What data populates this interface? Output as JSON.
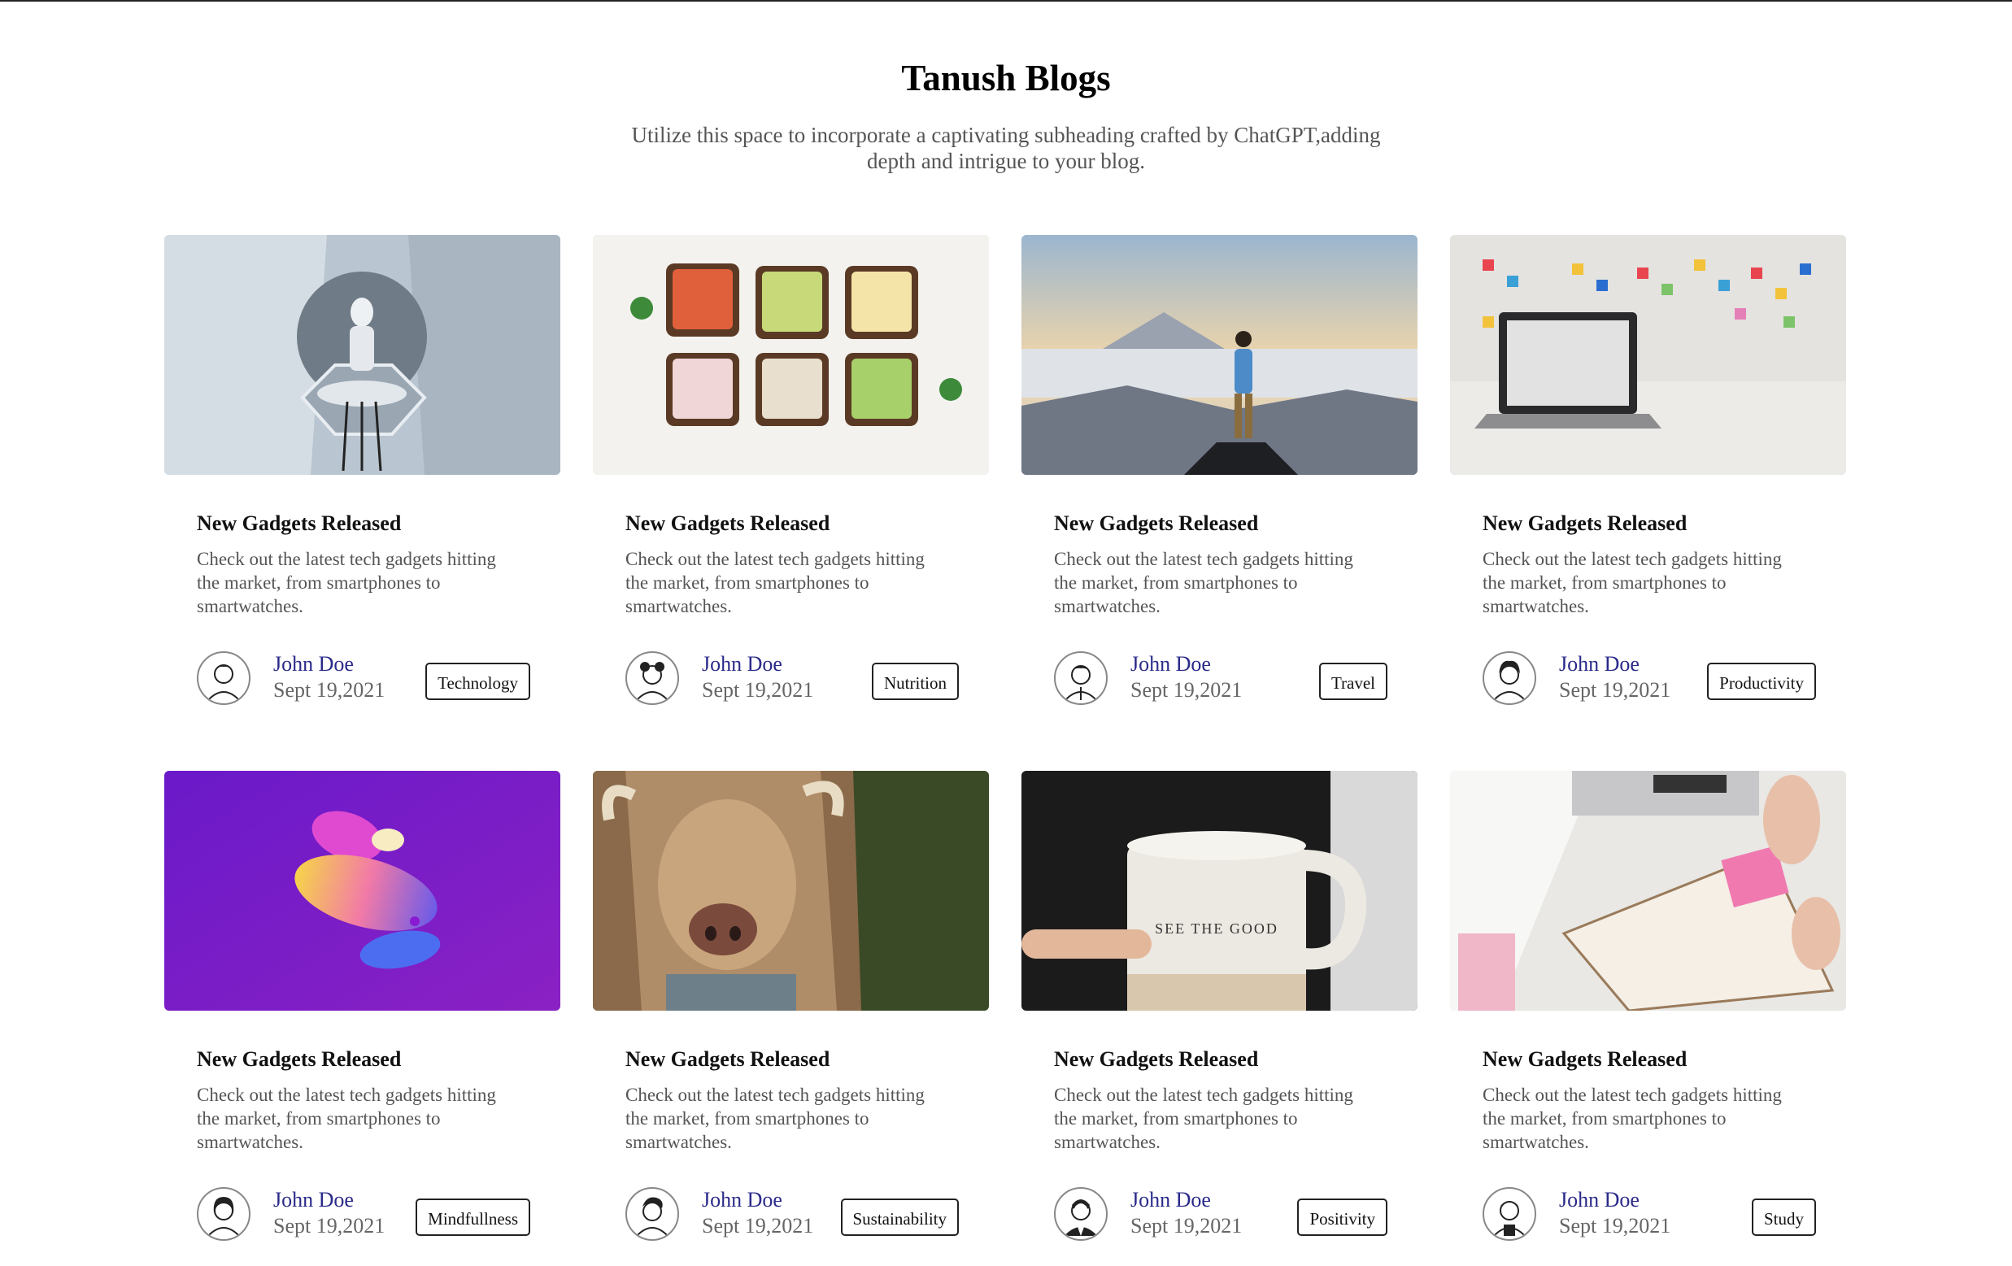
{
  "page": {
    "title": "Tanush Blogs",
    "subtitle": "Utilize this space to incorporate a captivating subheading crafted by ChatGPT,adding depth and intrigue to your blog."
  },
  "posts": [
    {
      "title": "New Gadgets Released",
      "description": "Check out the latest tech gadgets hitting the market, from smartphones to smartwatches.",
      "author": "John Doe",
      "date": "Sept 19,2021",
      "tag": "Technology",
      "image": "robot-meditating-image"
    },
    {
      "title": "New Gadgets Released",
      "description": "Check out the latest tech gadgets hitting the market, from smartphones to smartwatches.",
      "author": "John Doe",
      "date": "Sept 19,2021",
      "tag": "Nutrition",
      "image": "toast-snacks-image"
    },
    {
      "title": "New Gadgets Released",
      "description": "Check out the latest tech gadgets hitting the market, from smartphones to smartwatches.",
      "author": "John Doe",
      "date": "Sept 19,2021",
      "tag": "Travel",
      "image": "mountain-hiker-image"
    },
    {
      "title": "New Gadgets Released",
      "description": "Check out the latest tech gadgets hitting the market, from smartphones to smartwatches.",
      "author": "John Doe",
      "date": "Sept 19,2021",
      "tag": "Productivity",
      "image": "laptop-sticky-notes-image"
    },
    {
      "title": "New Gadgets Released",
      "description": "Check out the latest tech gadgets hitting the market, from smartphones to smartwatches.",
      "author": "John Doe",
      "date": "Sept 19,2021",
      "tag": "Mindfullness",
      "image": "abstract-3d-shape-image"
    },
    {
      "title": "New Gadgets Released",
      "description": "Check out the latest tech gadgets hitting the market, from smartphones to smartwatches.",
      "author": "John Doe",
      "date": "Sept 19,2021",
      "tag": "Sustainability",
      "image": "highland-cow-image"
    },
    {
      "title": "New Gadgets Released",
      "description": "Check out the latest tech gadgets hitting the market, from smartphones to smartwatches.",
      "author": "John Doe",
      "date": "Sept 19,2021",
      "tag": "Positivity",
      "image": "mug-see-the-good-image",
      "image_text": "SEE THE GOOD"
    },
    {
      "title": "New Gadgets Released",
      "description": "Check out the latest tech gadgets hitting the market, from smartphones to smartwatches.",
      "author": "John Doe",
      "date": "Sept 19,2021",
      "tag": "Study",
      "image": "planner-desk-image"
    }
  ],
  "colors": {
    "author_link": "#2a2a8a",
    "muted_text": "#555555",
    "tag_border": "#222222"
  }
}
